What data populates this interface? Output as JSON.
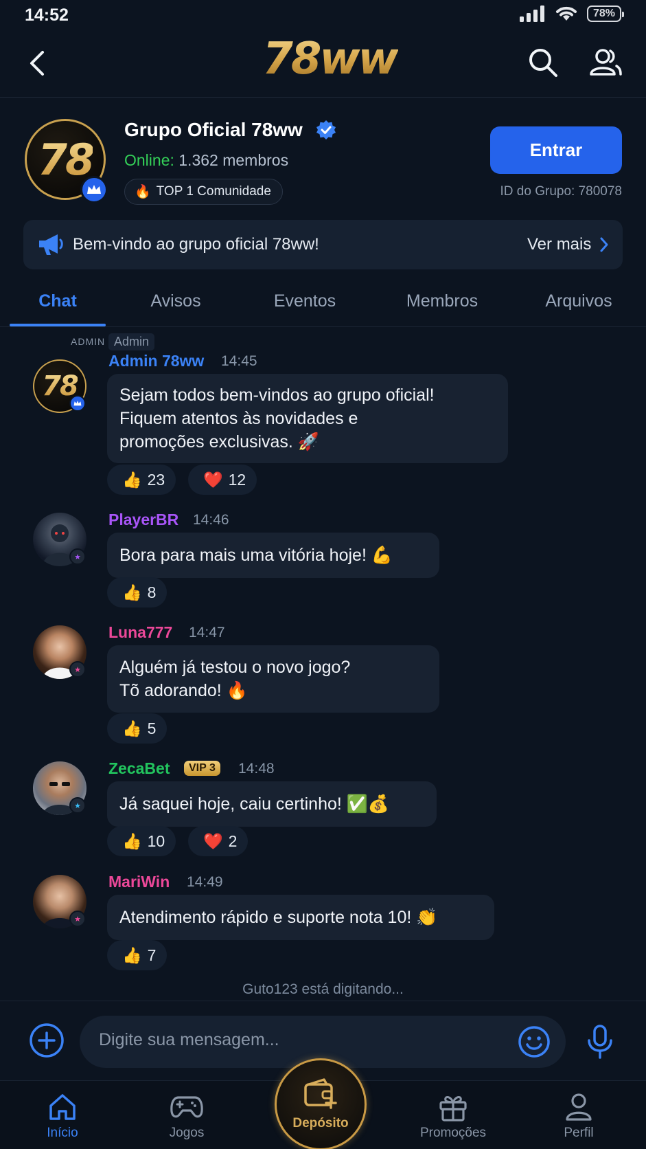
{
  "status_bar": {
    "time": "14:52",
    "battery": "78%"
  },
  "header": {
    "logo": "78ww"
  },
  "group": {
    "avatar_text": "78",
    "name": "Grupo Oficial 78ww",
    "online_label": "Online:",
    "member_count": "1.362 membros",
    "badge_emoji": "🔥",
    "badge_text": "TOP 1 Comunidade",
    "join_label": "Entrar",
    "group_id": "ID do Grupo: 780078"
  },
  "announcement": {
    "text": "Bem-vindo ao grupo oficial 78ww!",
    "more_label": "Ver mais"
  },
  "tabs": [
    {
      "label": "Chat",
      "active": true
    },
    {
      "label": "Avisos"
    },
    {
      "label": "Eventos"
    },
    {
      "label": "Membros"
    },
    {
      "label": "Arquivos"
    }
  ],
  "messages": [
    {
      "author": "Admin 78ww",
      "tag": "Admin",
      "mark": "ADMIN",
      "time": "14:45",
      "color": "#3b82f6",
      "lines": [
        "Sejam todos bem-vindos ao grupo oficial!",
        "Fiquem atentos às novidades e",
        "promoções exclusivas. 🚀"
      ],
      "reactions": [
        {
          "emoji": "👍",
          "count": "23"
        },
        {
          "emoji": "❤️",
          "count": "12"
        }
      ]
    },
    {
      "author": "PlayerBR",
      "time": "14:46",
      "color": "#a855f7",
      "lines": [
        "Bora para mais uma vitória hoje! 💪"
      ],
      "reactions": [
        {
          "emoji": "👍",
          "count": "8"
        }
      ]
    },
    {
      "author": "Luna777",
      "time": "14:47",
      "color": "#ec4899",
      "lines": [
        "Alguém já testou o novo jogo?",
        "Tõ adorando! 🔥"
      ],
      "reactions": [
        {
          "emoji": "👍",
          "count": "5"
        }
      ]
    },
    {
      "author": "ZecaBet",
      "vip": "VIP 3",
      "time": "14:48",
      "color": "#22c55e",
      "lines": [
        "Já saquei hoje, caiu certinho! ✅💰"
      ],
      "reactions": [
        {
          "emoji": "👍",
          "count": "10"
        },
        {
          "emoji": "❤️",
          "count": "2"
        }
      ]
    },
    {
      "author": "MariWin",
      "time": "14:49",
      "color": "#ec4899",
      "lines": [
        "Atendimento rápido e suporte nota 10! 👏"
      ],
      "reactions": [
        {
          "emoji": "👍",
          "count": "7"
        }
      ]
    }
  ],
  "typing": "Guto123 está digitando...",
  "composer": {
    "placeholder": "Digite sua mensagem..."
  },
  "nav": [
    {
      "label": "Início",
      "icon": "home-icon",
      "active": true
    },
    {
      "label": "Jogos",
      "icon": "gamepad-icon"
    },
    {
      "label": "Depósito",
      "icon": "wallet-icon"
    },
    {
      "label": "Promoções",
      "icon": "gift-icon"
    },
    {
      "label": "Perfil",
      "icon": "user-icon"
    }
  ],
  "colors": {
    "accent": "#3b82f6",
    "background": "#0c1420",
    "gold": "#c99a45",
    "online": "#34d058"
  }
}
